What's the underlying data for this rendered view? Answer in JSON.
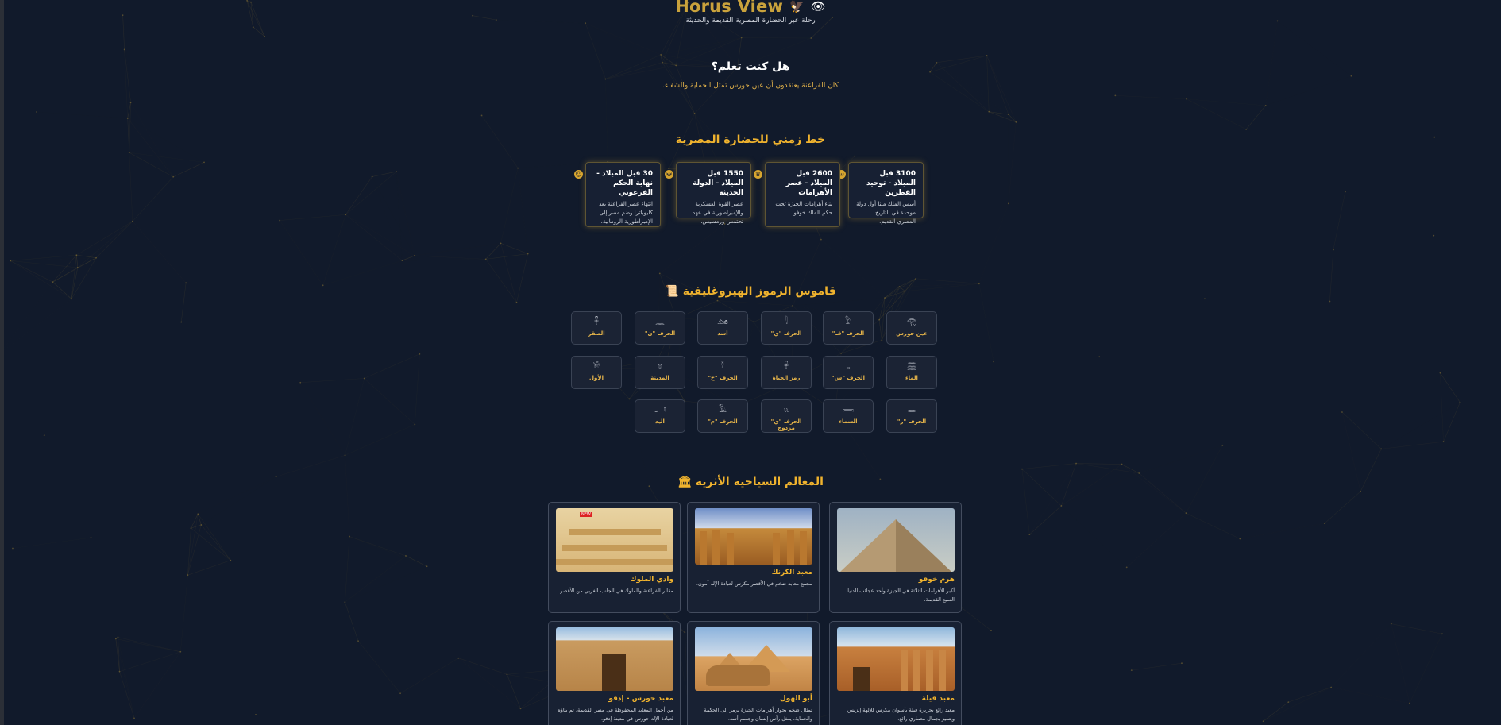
{
  "header": {
    "title": "Horus View",
    "icons": [
      "hawk-icon",
      "eye-icon"
    ],
    "subtitle": "رحلة عبر الحضارة المصرية القديمة والحديثة"
  },
  "did_you_know": {
    "title": "هل كنت تعلم؟",
    "text": "كان الفراعنة يعتقدون أن عين حورس تمثل الحماية والشفاء."
  },
  "timeline": {
    "title": "خط زمني للحضارة المصرية",
    "items": [
      {
        "heading": "3100 قبل الميلاد - توحيد القطرين",
        "body": "أسس الملك مينا أول دولة موحدة في التاريخ المصري القديم."
      },
      {
        "heading": "2600 قبل الميلاد - عصر الأهرامات",
        "body": "بناء أهرامات الجيزة تحت حكم الملك خوفو."
      },
      {
        "heading": "1550 قبل الميلاد - الدولة الحديثة",
        "body": "عصر القوة العسكرية والإمبراطورية في عهد تحتمس ورمسيس."
      },
      {
        "heading": "30 قبل الميلاد - نهاية الحكم الفرعوني",
        "body": "انتهاء عصر الفراعنة بعد كليوباترا وضم مصر إلى الإمبراطورية الرومانية."
      }
    ]
  },
  "hieroglyphs": {
    "title": "قاموس الرموز الهيروغليفية",
    "title_icon": "scroll-icon",
    "items": [
      {
        "symbol": "𓂀",
        "name": "عين حورس"
      },
      {
        "symbol": "𓅱",
        "name": "الحرف \"ف\""
      },
      {
        "symbol": "𓇋",
        "name": "الحرف \"ي\""
      },
      {
        "symbol": "𓃭",
        "name": "أسد"
      },
      {
        "symbol": "𓈖",
        "name": "الحرف \"ن\""
      },
      {
        "symbol": "𓋹",
        "name": "الصقر"
      },
      {
        "symbol": "𓈗",
        "name": "الماء"
      },
      {
        "symbol": "𓊃",
        "name": "الحرف \"س\""
      },
      {
        "symbol": "𓋹",
        "name": "رمز الحياة"
      },
      {
        "symbol": "𓎛",
        "name": "الحرف \"ح\""
      },
      {
        "symbol": "𓊖",
        "name": "المدينة"
      },
      {
        "symbol": "𓀀",
        "name": "الأول"
      },
      {
        "symbol": "𓂋",
        "name": "الحرف \"ر\""
      },
      {
        "symbol": "𓇯",
        "name": "السماء"
      },
      {
        "symbol": "𓏭",
        "name": "الحرف \"ي\" مزدوج"
      },
      {
        "symbol": "𓄿",
        "name": "الحرف \"م\""
      },
      {
        "symbol": "𓂝",
        "name": "اليد"
      }
    ]
  },
  "landmarks": {
    "title": "المعالم السياحية الأثرية",
    "title_icon": "museum-icon",
    "items": [
      {
        "name": "هرم خوفو",
        "desc": "أكبر الأهرامات الثلاثة في الجيزة وأحد عجائب الدنيا السبع القديمة."
      },
      {
        "name": "معبد الكرنك",
        "desc": "مجمع معابد ضخم في الأقصر مكرس لعبادة الإله آمون."
      },
      {
        "name": "وادي الملوك",
        "desc": "مقابر الفراعنة والملوك في الجانب الغربي من الأقصر."
      },
      {
        "name": "معبد فيلة",
        "desc": "معبد رائع بجزيرة فيلة بأسوان مكرس للإلهة إيزيس ويتميز بجمال معماري رائع."
      },
      {
        "name": "أبو الهول",
        "desc": "تمثال ضخم بجوار أهرامات الجيزة يرمز إلى الحكمة والحماية، يمثل رأس إنسان وجسم أسد."
      },
      {
        "name": "معبد حورس - إدفو",
        "desc": "من أجمل المعابد المحفوظة في مصر القديمة، تم بناؤه لعبادة الإله حورس في مدينة إدفو."
      }
    ],
    "badge": "NEW"
  },
  "colors": {
    "background": "#111a2b",
    "accent": "#f0b32e",
    "card": "#182133"
  }
}
